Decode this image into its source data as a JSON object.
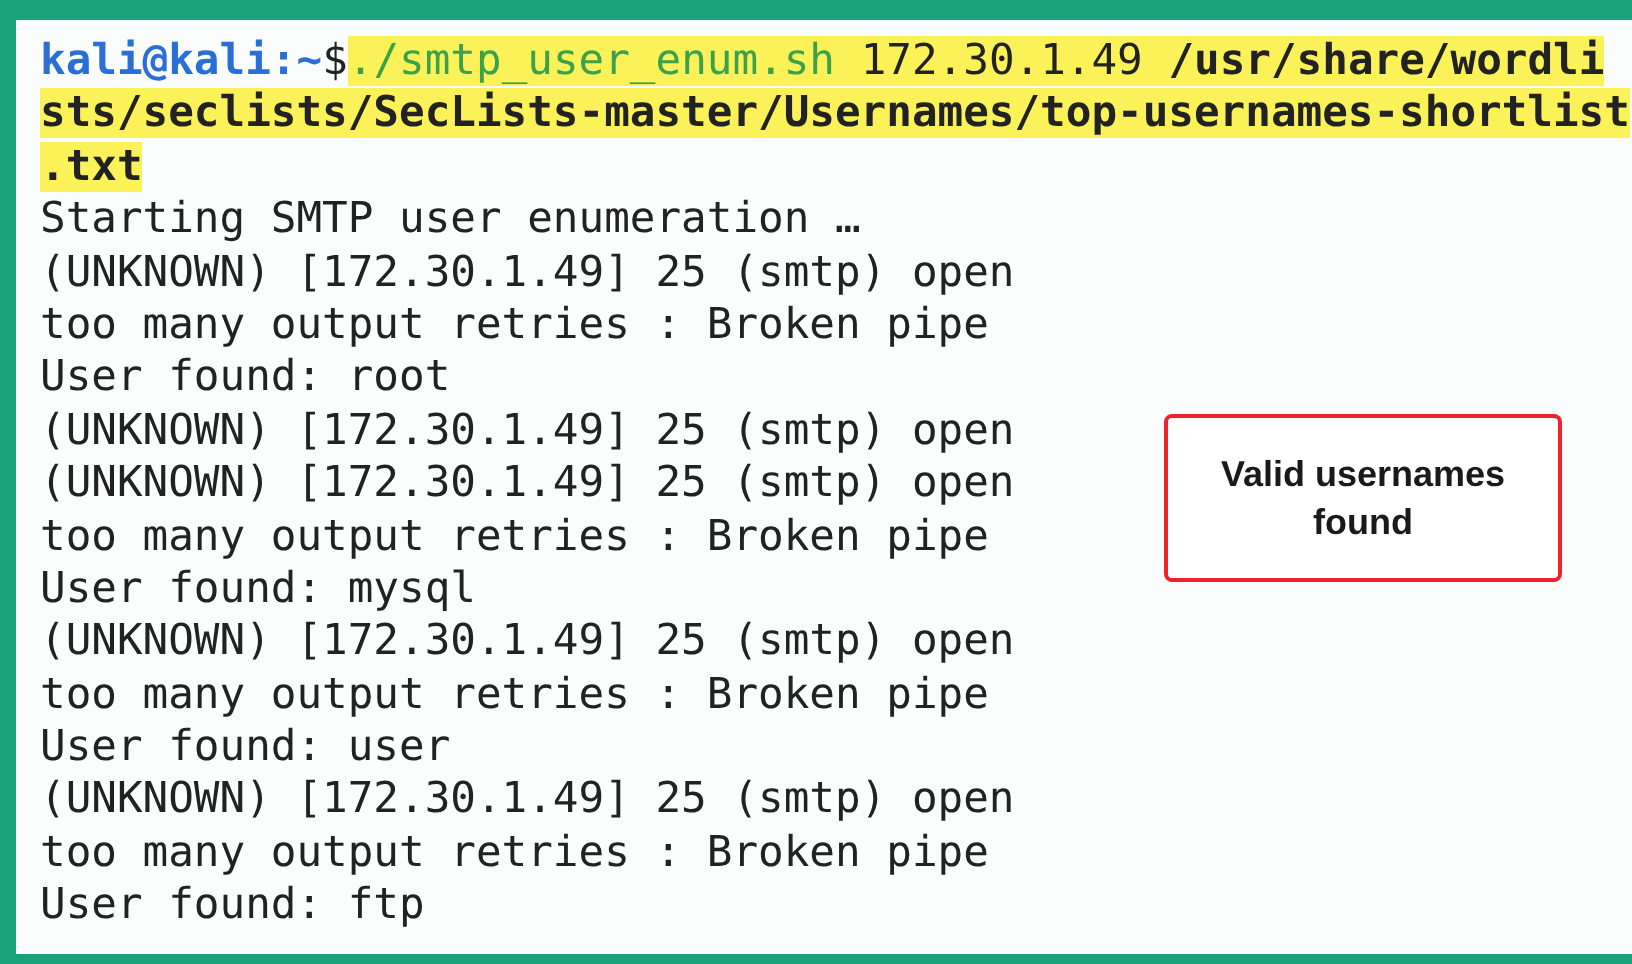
{
  "prompt": {
    "user": "kali@kali",
    "path": ":~",
    "symbol": "$"
  },
  "command_lines": [
    {
      "script": "./smtp_user_enum.sh",
      "text": " 172.30.1.49 **/usr/share/wordli**"
    },
    {
      "text": "**sts/seclists/SecLists-master/Usernames/top-usernames-shortlist**"
    },
    {
      "text": "**.txt**"
    }
  ],
  "output_lines": [
    "Starting SMTP user enumeration …",
    "(UNKNOWN) [172.30.1.49] 25 (smtp) open",
    "too many output retries : Broken pipe",
    "User found: root",
    "(UNKNOWN) [172.30.1.49] 25 (smtp) open",
    "(UNKNOWN) [172.30.1.49] 25 (smtp) open",
    "too many output retries : Broken pipe",
    "User found: mysql",
    "(UNKNOWN) [172.30.1.49] 25 (smtp) open",
    "too many output retries : Broken pipe",
    "User found: user",
    "(UNKNOWN) [172.30.1.49] 25 (smtp) open",
    "too many output retries : Broken pipe",
    "User found: ftp"
  ],
  "callout": {
    "text": "Valid usernames found"
  }
}
